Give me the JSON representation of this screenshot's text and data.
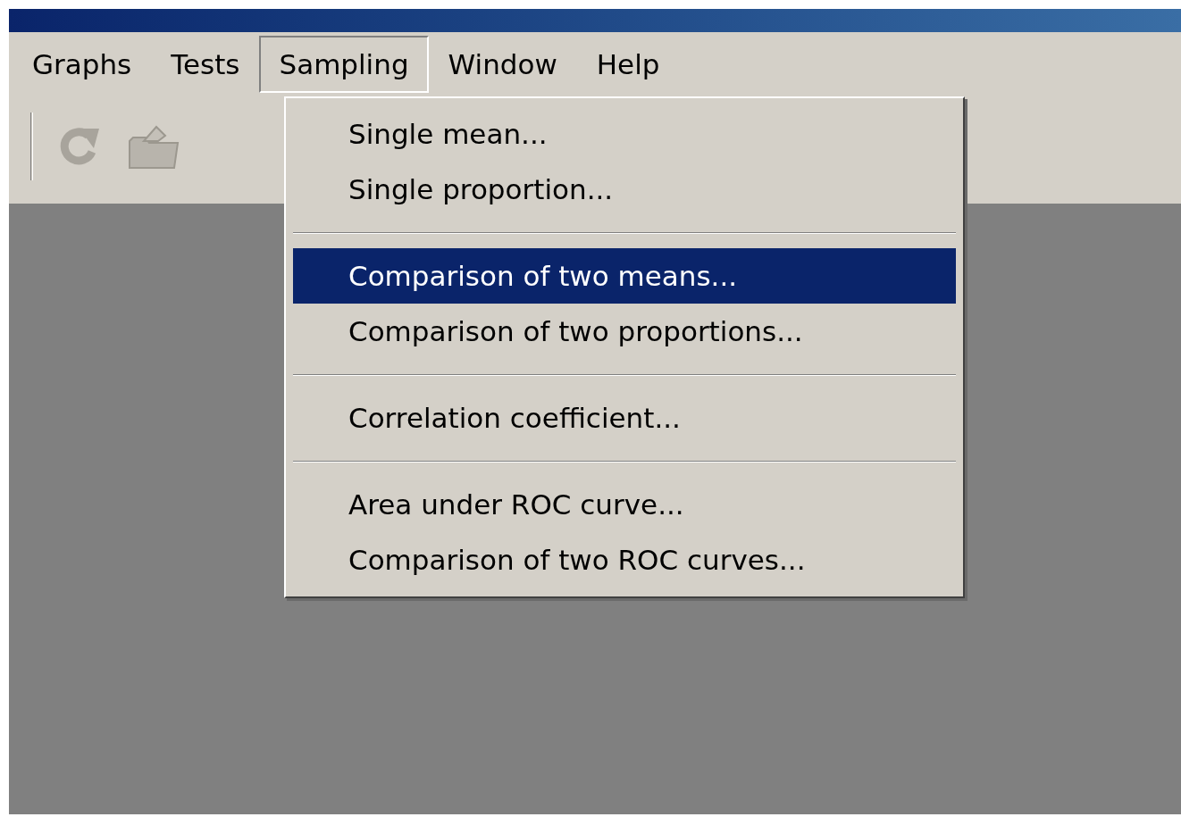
{
  "menu_bar": [
    {
      "label": "Graphs",
      "selected": false
    },
    {
      "label": "Tests",
      "selected": false
    },
    {
      "label": "Sampling",
      "selected": true
    },
    {
      "label": "Window",
      "selected": false
    },
    {
      "label": "Help",
      "selected": false
    }
  ],
  "dropdown": [
    {
      "kind": "item",
      "label": "Single mean...",
      "selected": false
    },
    {
      "kind": "item",
      "label": "Single proportion...",
      "selected": false
    },
    {
      "kind": "separator"
    },
    {
      "kind": "item",
      "label": "Comparison of two means...",
      "selected": true
    },
    {
      "kind": "item",
      "label": "Comparison of two proportions...",
      "selected": false
    },
    {
      "kind": "separator"
    },
    {
      "kind": "item",
      "label": "Correlation coefficient...",
      "selected": false
    },
    {
      "kind": "separator"
    },
    {
      "kind": "item",
      "label": "Area under ROC curve...",
      "selected": false
    },
    {
      "kind": "item",
      "label": "Comparison of two ROC curves...",
      "selected": false
    }
  ]
}
